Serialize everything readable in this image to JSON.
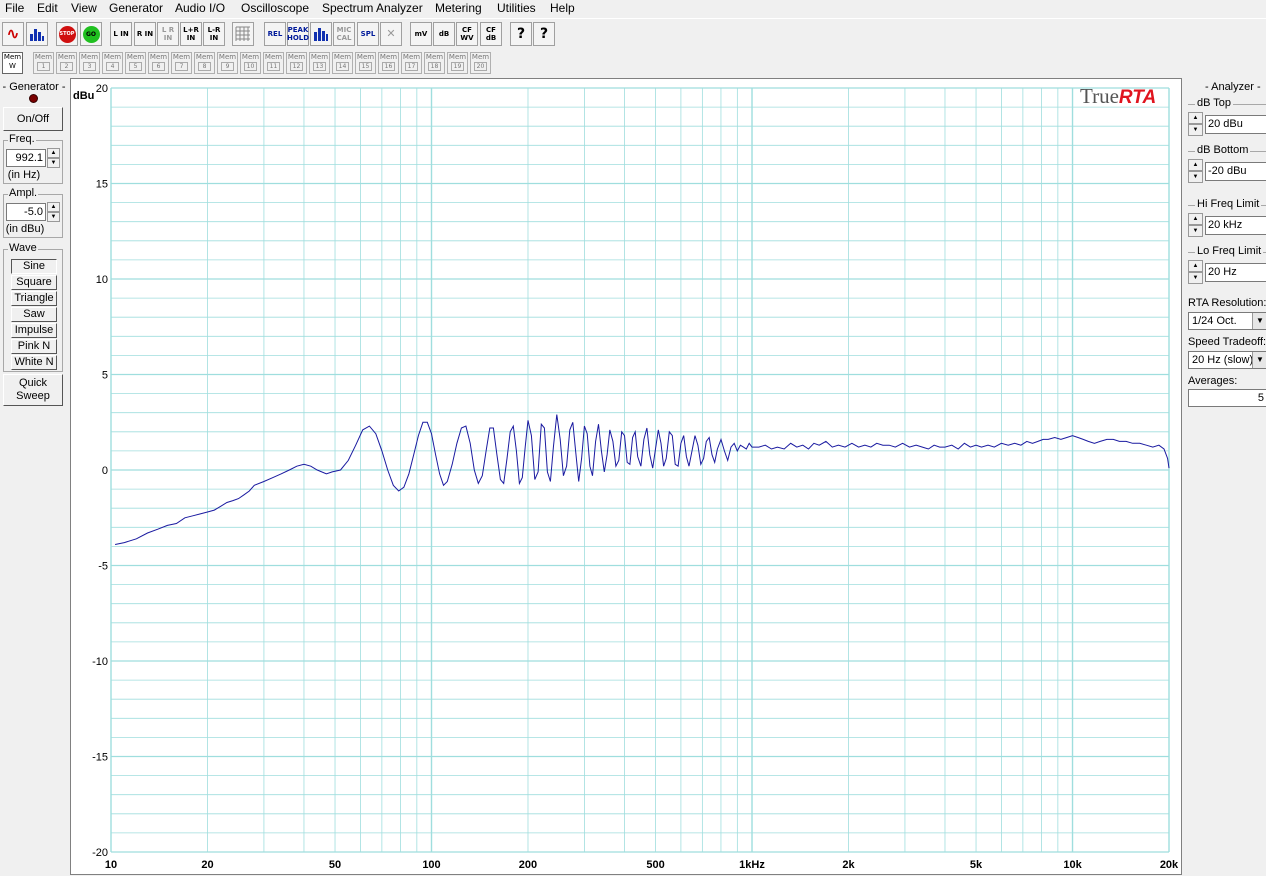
{
  "menu": [
    "File",
    "Edit",
    "View",
    "Generator",
    "Audio I/O",
    "Oscilloscope",
    "Spectrum Analyzer",
    "Metering",
    "Utilities",
    "Help"
  ],
  "toolbar": {
    "buttons": [
      {
        "name": "sine-wave-icon",
        "label": "∿"
      },
      {
        "name": "spectrum-icon",
        "label": ""
      },
      {
        "name": "stop-button",
        "label": "STOP"
      },
      {
        "name": "go-button",
        "label": "GO"
      },
      {
        "name": "l-in-button",
        "label": "L IN"
      },
      {
        "name": "r-in-button",
        "label": "R IN"
      },
      {
        "name": "lr-in-button",
        "label": "L R IN"
      },
      {
        "name": "l-plus-r-in-button",
        "label": "L+R IN"
      },
      {
        "name": "l-minus-r-in-button",
        "label": "L-R IN"
      },
      {
        "name": "grid-icon",
        "label": ""
      },
      {
        "name": "rel-button",
        "label": "REL"
      },
      {
        "name": "peak-hold-button",
        "label": "PEAK HOLD"
      },
      {
        "name": "bars-icon",
        "label": ""
      },
      {
        "name": "mic-cal-button",
        "label": "MIC CAL"
      },
      {
        "name": "spl-button",
        "label": "SPL"
      },
      {
        "name": "close-icon",
        "label": "✕"
      },
      {
        "name": "mv-button",
        "label": "mV"
      },
      {
        "name": "db-button",
        "label": "dB"
      },
      {
        "name": "cf-wv-button",
        "label": "CF WV"
      },
      {
        "name": "cf-db-button",
        "label": "CF dB"
      },
      {
        "name": "help-icon",
        "label": "?"
      },
      {
        "name": "context-help-icon",
        "label": "?"
      }
    ]
  },
  "memory": {
    "active_label": "Mem",
    "active_sub": "W",
    "label": "Mem",
    "slots": [
      "1",
      "2",
      "3",
      "4",
      "5",
      "6",
      "7",
      "8",
      "9",
      "10",
      "11",
      "12",
      "13",
      "14",
      "15",
      "16",
      "17",
      "18",
      "19",
      "20"
    ]
  },
  "generator": {
    "title": "- Generator -",
    "onoff": "On/Off",
    "freq_title": "Freq.",
    "freq_value": "992.1",
    "freq_unit": "(in Hz)",
    "ampl_title": "Ampl.",
    "ampl_value": "-5.0",
    "ampl_unit": "(in dBu)",
    "wave_title": "Wave",
    "waves": [
      "Sine",
      "Square",
      "Triangle",
      "Saw",
      "Impulse",
      "Pink N",
      "White N"
    ],
    "selected_wave": "Sine",
    "quick_sweep_1": "Quick",
    "quick_sweep_2": "Sweep"
  },
  "analyzer": {
    "title": "- Analyzer -",
    "db_top_label": "dB Top",
    "db_top_value": "20 dBu",
    "db_bottom_label": "dB Bottom",
    "db_bottom_value": "-20 dBu",
    "hi_freq_label": "Hi Freq Limit",
    "hi_freq_value": "20 kHz",
    "lo_freq_label": "Lo Freq Limit",
    "lo_freq_value": "20 Hz",
    "rta_res_label": "RTA Resolution:",
    "rta_res_value": "1/24 Oct.",
    "speed_label": "Speed Tradeoff:",
    "speed_value": "20 Hz (slow)",
    "averages_label": "Averages:",
    "averages_value": "5"
  },
  "logo": {
    "part1": "True",
    "part2": "RTA"
  },
  "colors": {
    "grid": "#9fdede",
    "trace": "#1a1aa0",
    "logo_true": "#555555",
    "logo_rta": "#e0141e"
  },
  "chart_data": {
    "type": "line",
    "title": "",
    "xlabel": "",
    "ylabel": "dBu",
    "xscale": "log",
    "xlim": [
      10,
      20000
    ],
    "ylim": [
      -20,
      20
    ],
    "yticks": [
      20,
      15,
      10,
      5,
      0,
      -5,
      -10,
      -15,
      -20
    ],
    "xticks": [
      {
        "v": 10,
        "label": "10"
      },
      {
        "v": 20,
        "label": "20"
      },
      {
        "v": 50,
        "label": "50"
      },
      {
        "v": 100,
        "label": "100"
      },
      {
        "v": 200,
        "label": "200"
      },
      {
        "v": 500,
        "label": "500"
      },
      {
        "v": 1000,
        "label": "1kHz"
      },
      {
        "v": 2000,
        "label": "2k"
      },
      {
        "v": 5000,
        "label": "5k"
      },
      {
        "v": 10000,
        "label": "10k"
      },
      {
        "v": 20000,
        "label": "20k"
      }
    ],
    "series": [
      {
        "values": [
          [
            10.3,
            -3.9
          ],
          [
            11,
            -3.8
          ],
          [
            12,
            -3.6
          ],
          [
            13,
            -3.3
          ],
          [
            14,
            -3.1
          ],
          [
            15,
            -2.9
          ],
          [
            16,
            -2.8
          ],
          [
            17,
            -2.5
          ],
          [
            18,
            -2.4
          ],
          [
            19,
            -2.3
          ],
          [
            20,
            -2.2
          ],
          [
            21,
            -2.1
          ],
          [
            22,
            -1.9
          ],
          [
            23,
            -1.7
          ],
          [
            24,
            -1.6
          ],
          [
            25,
            -1.5
          ],
          [
            26,
            -1.3
          ],
          [
            27,
            -1.1
          ],
          [
            28,
            -0.8
          ],
          [
            30,
            -0.6
          ],
          [
            32,
            -0.4
          ],
          [
            34,
            -0.2
          ],
          [
            36,
            0.0
          ],
          [
            38,
            0.2
          ],
          [
            40,
            0.3
          ],
          [
            42,
            0.2
          ],
          [
            44,
            0.0
          ],
          [
            47,
            -0.2
          ],
          [
            49,
            -0.1
          ],
          [
            52,
            0.0
          ],
          [
            55,
            0.5
          ],
          [
            58,
            1.3
          ],
          [
            61,
            2.1
          ],
          [
            64,
            2.3
          ],
          [
            67,
            1.9
          ],
          [
            70,
            1.0
          ],
          [
            73,
            0.0
          ],
          [
            76,
            -0.8
          ],
          [
            79,
            -1.1
          ],
          [
            82,
            -0.9
          ],
          [
            85,
            -0.2
          ],
          [
            88,
            0.8
          ],
          [
            91,
            1.8
          ],
          [
            94,
            2.5
          ],
          [
            97,
            2.5
          ],
          [
            100,
            1.9
          ],
          [
            103,
            0.8
          ],
          [
            106,
            -0.2
          ],
          [
            109,
            -0.8
          ],
          [
            112,
            -0.6
          ],
          [
            116,
            0.3
          ],
          [
            120,
            1.4
          ],
          [
            124,
            2.2
          ],
          [
            128,
            2.3
          ],
          [
            132,
            1.4
          ],
          [
            136,
            0.0
          ],
          [
            140,
            -0.7
          ],
          [
            144,
            -0.3
          ],
          [
            148,
            1.0
          ],
          [
            152,
            2.2
          ],
          [
            156,
            2.2
          ],
          [
            160,
            0.8
          ],
          [
            164,
            -0.5
          ],
          [
            168,
            -0.7
          ],
          [
            172,
            0.6
          ],
          [
            176,
            2.0
          ],
          [
            180,
            2.3
          ],
          [
            184,
            1.0
          ],
          [
            188,
            -0.7
          ],
          [
            192,
            -0.4
          ],
          [
            196,
            1.2
          ],
          [
            200,
            2.6
          ],
          [
            205,
            1.8
          ],
          [
            210,
            -0.5
          ],
          [
            215,
            -0.1
          ],
          [
            220,
            2.4
          ],
          [
            225,
            2.2
          ],
          [
            230,
            -0.1
          ],
          [
            235,
            -0.6
          ],
          [
            240,
            1.2
          ],
          [
            246,
            2.9
          ],
          [
            252,
            1.6
          ],
          [
            258,
            -0.3
          ],
          [
            264,
            0.2
          ],
          [
            270,
            2.1
          ],
          [
            276,
            2.5
          ],
          [
            282,
            0.9
          ],
          [
            288,
            -0.6
          ],
          [
            294,
            0.6
          ],
          [
            300,
            2.3
          ],
          [
            306,
            1.9
          ],
          [
            312,
            0.2
          ],
          [
            318,
            -0.3
          ],
          [
            325,
            1.5
          ],
          [
            332,
            2.4
          ],
          [
            339,
            1.0
          ],
          [
            346,
            -0.1
          ],
          [
            353,
            0.8
          ],
          [
            360,
            2.1
          ],
          [
            368,
            1.5
          ],
          [
            376,
            0.2
          ],
          [
            384,
            0.5
          ],
          [
            392,
            2.0
          ],
          [
            400,
            1.8
          ],
          [
            408,
            0.4
          ],
          [
            416,
            0.3
          ],
          [
            424,
            1.7
          ],
          [
            432,
            2.0
          ],
          [
            440,
            0.7
          ],
          [
            450,
            0.2
          ],
          [
            460,
            1.6
          ],
          [
            470,
            2.2
          ],
          [
            480,
            0.8
          ],
          [
            490,
            0.1
          ],
          [
            500,
            1.1
          ],
          [
            510,
            2.1
          ],
          [
            520,
            1.4
          ],
          [
            530,
            0.2
          ],
          [
            540,
            0.6
          ],
          [
            552,
            2.0
          ],
          [
            564,
            1.8
          ],
          [
            576,
            0.3
          ],
          [
            588,
            0.2
          ],
          [
            600,
            1.4
          ],
          [
            612,
            1.8
          ],
          [
            624,
            0.7
          ],
          [
            636,
            0.2
          ],
          [
            650,
            1.0
          ],
          [
            664,
            1.8
          ],
          [
            678,
            1.3
          ],
          [
            692,
            0.3
          ],
          [
            706,
            0.6
          ],
          [
            720,
            1.5
          ],
          [
            735,
            1.7
          ],
          [
            750,
            0.8
          ],
          [
            765,
            0.4
          ],
          [
            780,
            1.1
          ],
          [
            800,
            1.6
          ],
          [
            820,
            1.0
          ],
          [
            840,
            0.5
          ],
          [
            860,
            1.2
          ],
          [
            880,
            1.4
          ],
          [
            900,
            1.0
          ],
          [
            920,
            1.3
          ],
          [
            940,
            1.2
          ],
          [
            960,
            1.1
          ],
          [
            980,
            1.4
          ],
          [
            1000,
            1.2
          ],
          [
            1050,
            1.2
          ],
          [
            1100,
            1.3
          ],
          [
            1150,
            1.1
          ],
          [
            1200,
            1.2
          ],
          [
            1260,
            1.1
          ],
          [
            1320,
            1.4
          ],
          [
            1380,
            1.2
          ],
          [
            1440,
            1.3
          ],
          [
            1500,
            1.1
          ],
          [
            1560,
            1.4
          ],
          [
            1620,
            1.3
          ],
          [
            1700,
            1.5
          ],
          [
            1780,
            1.2
          ],
          [
            1860,
            1.3
          ],
          [
            1950,
            1.2
          ],
          [
            2050,
            1.4
          ],
          [
            2150,
            1.2
          ],
          [
            2250,
            1.3
          ],
          [
            2350,
            1.2
          ],
          [
            2450,
            1.4
          ],
          [
            2560,
            1.3
          ],
          [
            2680,
            1.3
          ],
          [
            2800,
            1.2
          ],
          [
            2950,
            1.4
          ],
          [
            3100,
            1.2
          ],
          [
            3250,
            1.3
          ],
          [
            3400,
            1.2
          ],
          [
            3550,
            1.1
          ],
          [
            3700,
            1.3
          ],
          [
            3850,
            1.2
          ],
          [
            4000,
            1.2
          ],
          [
            4200,
            1.3
          ],
          [
            4400,
            1.1
          ],
          [
            4600,
            1.4
          ],
          [
            4800,
            1.2
          ],
          [
            5000,
            1.3
          ],
          [
            5200,
            1.2
          ],
          [
            5450,
            1.3
          ],
          [
            5700,
            1.2
          ],
          [
            6000,
            1.4
          ],
          [
            6300,
            1.3
          ],
          [
            6600,
            1.4
          ],
          [
            6900,
            1.3
          ],
          [
            7200,
            1.5
          ],
          [
            7500,
            1.4
          ],
          [
            7800,
            1.5
          ],
          [
            8100,
            1.6
          ],
          [
            8400,
            1.6
          ],
          [
            8800,
            1.7
          ],
          [
            9200,
            1.6
          ],
          [
            9600,
            1.7
          ],
          [
            10000,
            1.8
          ],
          [
            10400,
            1.7
          ],
          [
            10800,
            1.6
          ],
          [
            11200,
            1.5
          ],
          [
            11700,
            1.4
          ],
          [
            12200,
            1.5
          ],
          [
            12800,
            1.6
          ],
          [
            13400,
            1.6
          ],
          [
            14000,
            1.5
          ],
          [
            14700,
            1.5
          ],
          [
            15400,
            1.4
          ],
          [
            16200,
            1.4
          ],
          [
            17000,
            1.3
          ],
          [
            17800,
            1.2
          ],
          [
            18600,
            1.3
          ],
          [
            19300,
            1.1
          ],
          [
            19800,
            0.6
          ],
          [
            20000,
            0.1
          ]
        ]
      }
    ],
    "grid": true,
    "legend": "none"
  }
}
